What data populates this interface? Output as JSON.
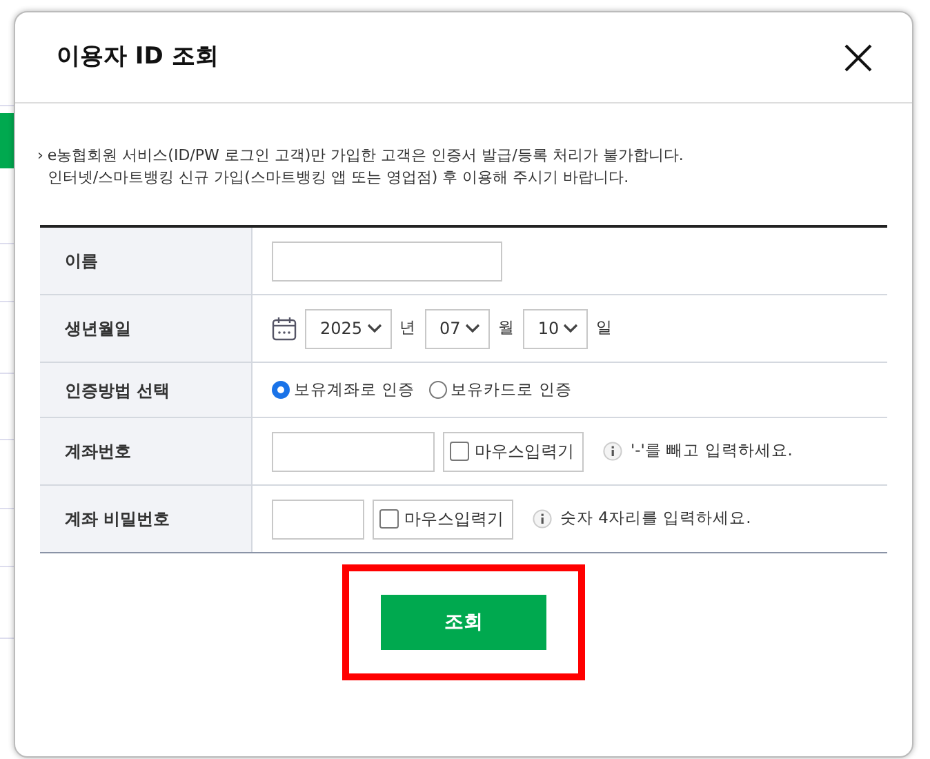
{
  "dialog": {
    "title": "이용자 ID 조회",
    "notice": {
      "bullet": "›",
      "lines": [
        "e농협회원 서비스(ID/PW 로그인 고객)만 가입한 고객은 인증서 발급/등록 처리가 불가합니다.",
        "인터넷/스마트뱅킹 신규 가입(스마트뱅킹 앱 또는 영업점) 후 이용해 주시기 바랍니다."
      ]
    },
    "fields": [
      {
        "kind": "text",
        "label": "이름"
      },
      {
        "kind": "date",
        "label": "생년월일",
        "parts": [
          {
            "value": "2025",
            "unit": "년"
          },
          {
            "value": "07",
            "unit": "월"
          },
          {
            "value": "10",
            "unit": "일"
          }
        ]
      },
      {
        "kind": "radio",
        "label": "인증방법 선택",
        "options": [
          {
            "label": "보유계좌로 인증",
            "selected": true
          },
          {
            "label": "보유카드로 인증",
            "selected": false
          }
        ]
      },
      {
        "kind": "account",
        "label": "계좌번호",
        "checkbox": {
          "label": "마우스입력기",
          "checked": false
        },
        "hint": "'-'를 빼고 입력하세요."
      },
      {
        "kind": "pin",
        "label": "계좌 비밀번호",
        "checkbox": {
          "label": "마우스입력기",
          "checked": false
        },
        "hint": "숫자 4자리를 입력하세요."
      }
    ],
    "submit": "조회"
  }
}
